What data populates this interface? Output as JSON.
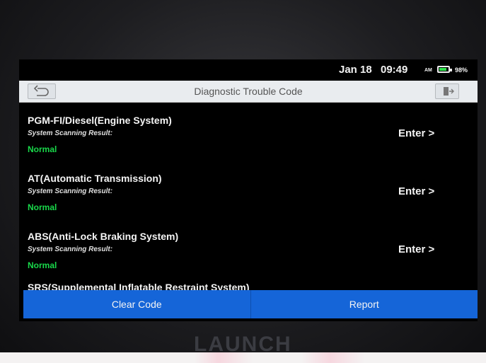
{
  "status": {
    "date": "Jan 18",
    "time": "09:49",
    "ampm": "AM",
    "battery_percent": "98%",
    "battery_level": 0.85,
    "battery_color": "#2de04a"
  },
  "header": {
    "title": "Diagnostic Trouble Code",
    "back_icon": "back-arrow-icon",
    "exit_icon": "exit-icon"
  },
  "systems": [
    {
      "name": "PGM-FI/Diesel(Engine System)",
      "subtitle": "System Scanning Result:",
      "status": "Normal",
      "action": "Enter >"
    },
    {
      "name": "AT(Automatic Transmission)",
      "subtitle": "System Scanning Result:",
      "status": "Normal",
      "action": "Enter >"
    },
    {
      "name": "ABS(Anti-Lock Braking System)",
      "subtitle": "System Scanning Result:",
      "status": "Normal",
      "action": "Enter >"
    },
    {
      "name": "SRS(Supplemental Inflatable Restraint System)"
    }
  ],
  "footer": {
    "clear_code_label": "Clear Code",
    "report_label": "Report"
  },
  "device": {
    "brand": "LAUNCH"
  },
  "colors": {
    "accent": "#1565d8",
    "status_normal": "#19d84a"
  }
}
